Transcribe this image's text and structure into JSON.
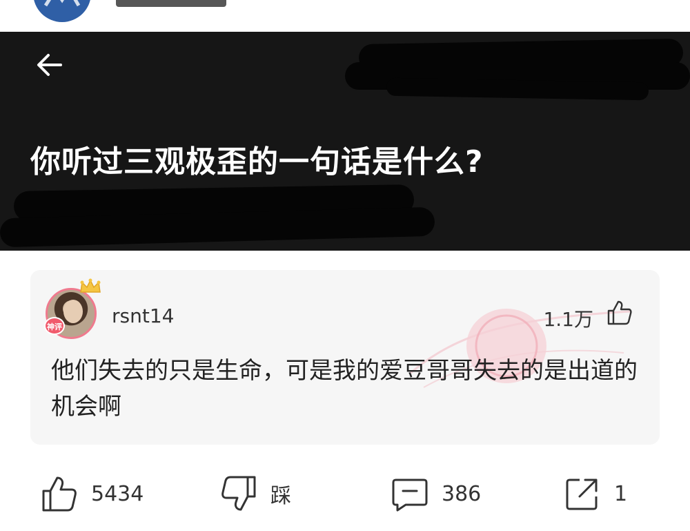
{
  "post": {
    "title": "你听过三观极歪的一句话是什么?"
  },
  "comment": {
    "username": "rsnt14",
    "like_count": "1.1万",
    "text": "他们失去的只是生命，可是我的爱豆哥哥失去的是出道的机会啊",
    "badge": "神评"
  },
  "actions": {
    "likes": "5434",
    "dislike_label": "踩",
    "comments": "386",
    "shares": "1"
  }
}
